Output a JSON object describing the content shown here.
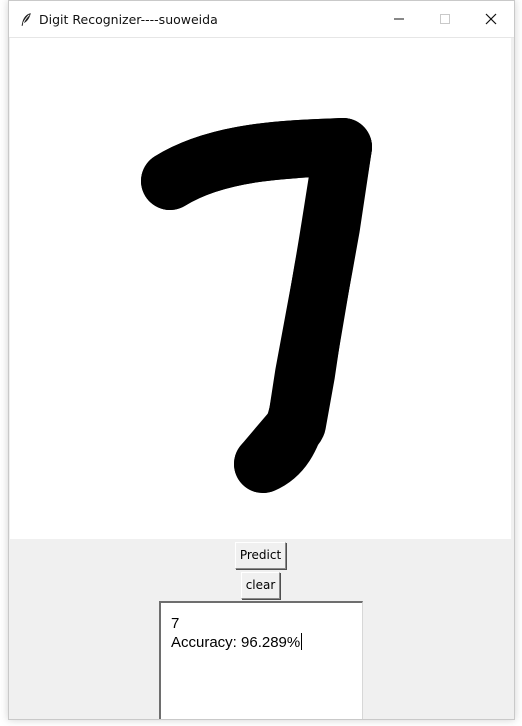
{
  "window": {
    "title": "Digit Recognizer----suoweida"
  },
  "icons": {
    "app": "feather-icon",
    "minimize": "minimize-icon",
    "maximize": "maximize-icon",
    "close": "close-icon"
  },
  "canvas": {
    "drawn_stroke_color": "#000000",
    "background_color": "#ffffff"
  },
  "buttons": {
    "predict_label": "Predict",
    "clear_label": "clear"
  },
  "result": {
    "digit": "7",
    "accuracy_text": "Accuracy: 96.289%"
  }
}
